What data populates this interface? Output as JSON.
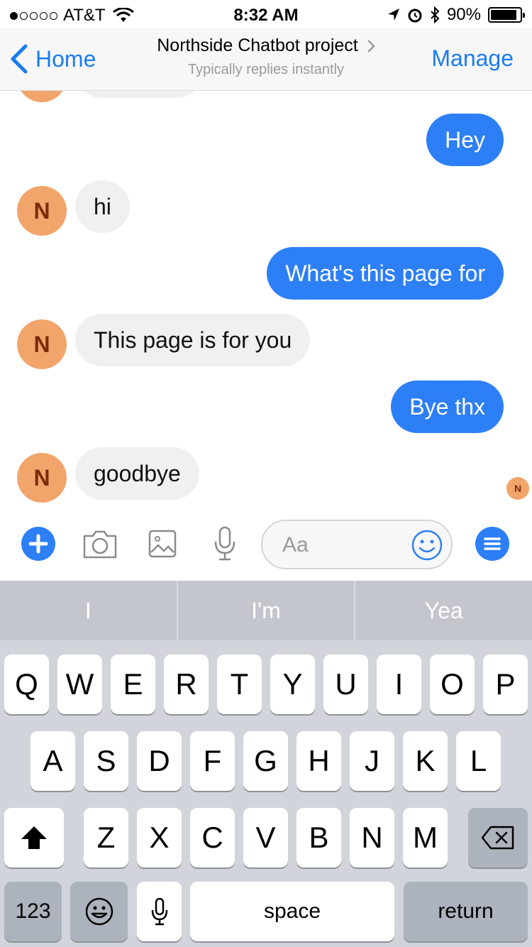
{
  "status_bar": {
    "carrier": "AT&T",
    "time": "8:32 AM",
    "battery": "90%",
    "battery_level": 0.9
  },
  "nav": {
    "back_label": "Home",
    "title": "Northside Chatbot project",
    "subtitle": "Typically replies instantly",
    "manage_label": "Manage"
  },
  "conversation": {
    "avatar_initial": "N",
    "messages": [
      {
        "from": "me",
        "text": "Hey"
      },
      {
        "from": "bot",
        "text": "hi"
      },
      {
        "from": "me",
        "text": "What's this page for"
      },
      {
        "from": "bot",
        "text": "This page is for you"
      },
      {
        "from": "me",
        "text": "Bye thx"
      },
      {
        "from": "bot",
        "text": "goodbye"
      }
    ],
    "read_receipt_initial": "N"
  },
  "composer": {
    "placeholder": "Aa",
    "icons": [
      "plus-icon",
      "camera-icon",
      "gallery-icon",
      "microphone-icon",
      "emoji-icon",
      "menu-icon"
    ]
  },
  "keyboard": {
    "suggestions": [
      "I",
      "I'm",
      "Yea"
    ],
    "row1": [
      "Q",
      "W",
      "E",
      "R",
      "T",
      "Y",
      "U",
      "I",
      "O",
      "P"
    ],
    "row2": [
      "A",
      "S",
      "D",
      "F",
      "G",
      "H",
      "J",
      "K",
      "L"
    ],
    "row3": [
      "Z",
      "X",
      "C",
      "V",
      "B",
      "N",
      "M"
    ],
    "numbers_label": "123",
    "space_label": "space",
    "return_label": "return"
  },
  "colors": {
    "accent": "#2d7ff6",
    "link": "#1b7cf1",
    "avatar": "#f2a56b"
  }
}
